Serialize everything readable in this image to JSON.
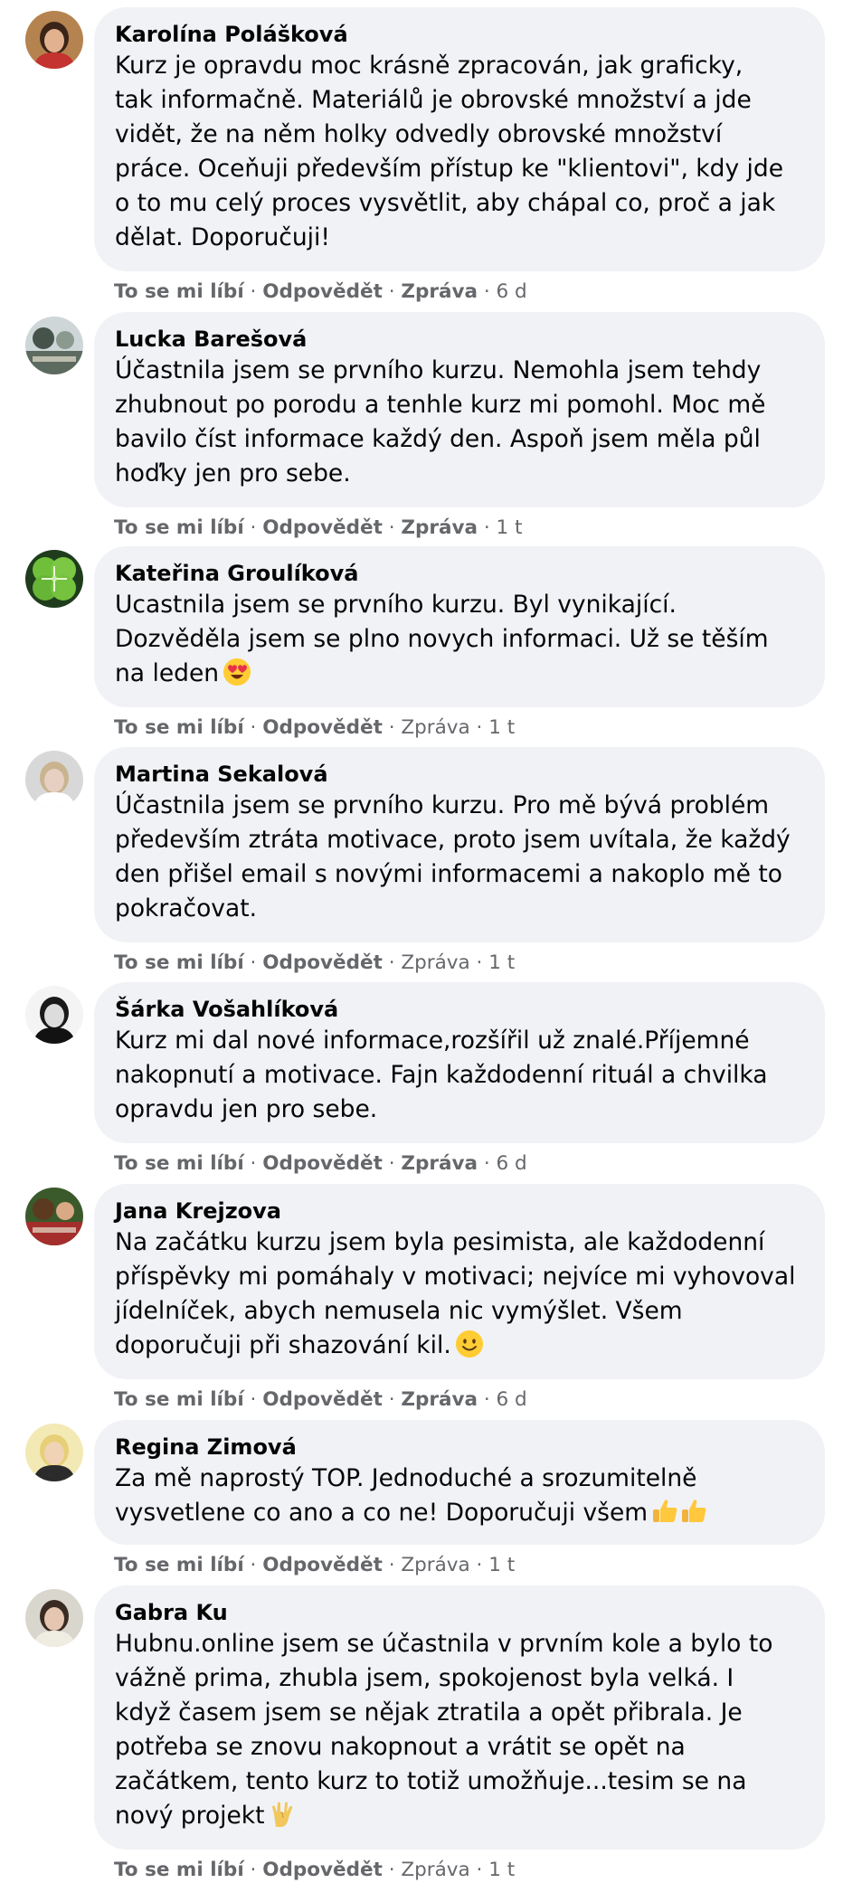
{
  "comments": [
    {
      "author": "Karolína Polášková",
      "lines": [
        "Kurz je opravdu moc krásně zpracován, jak graficky,",
        "tak informačně. Materiálů je obrovské množství a jde",
        "vidět, že na něm holky odvedly obrovské množství",
        "práce. Oceňuji především přístup ke \"klientovi\", kdy jde",
        "o to mu celý proces vysvětlit, aby chápal co, proč a jak",
        "dělat. Doporučuji!"
      ],
      "like": "To se mi líbí",
      "reply": "Odpovědět",
      "message": "Zpráva",
      "message_bold": true,
      "time": "6 d"
    },
    {
      "author": "Lucka Barešová",
      "lines": [
        "Účastnila jsem se prvního kurzu. Nemohla jsem tehdy",
        "zhubnout po porodu a tenhle kurz mi pomohl. Moc mě",
        "bavilo číst informace každý den. Aspoň jsem měla půl",
        "hoďky jen pro sebe."
      ],
      "like": "To se mi líbí",
      "reply": "Odpovědět",
      "message": "Zpráva",
      "message_bold": true,
      "time": "1 t"
    },
    {
      "author": "Kateřina Groulíková",
      "lines": [
        "Ucastnila jsem se prvního kurzu. Byl vynikající.",
        "Dozvěděla jsem se plno novych informaci. Už se těším",
        "na leden"
      ],
      "emoji": "heart-eyes-emoji",
      "like": "To se mi líbí",
      "reply": "Odpovědět",
      "message": "Zpráva",
      "message_bold": false,
      "time": "1 t"
    },
    {
      "author": "Martina Sekalová",
      "lines": [
        "Účastnila jsem se prvního kurzu. Pro mě bývá problém",
        "především ztráta motivace, proto jsem uvítala, že každý",
        "den přišel email s novými informacemi a nakoplo mě to",
        "pokračovat."
      ],
      "like": "To se mi líbí",
      "reply": "Odpovědět",
      "message": "Zpráva",
      "message_bold": false,
      "time": "1 t"
    },
    {
      "author": "Šárka Vošahlíková",
      "lines": [
        "Kurz mi dal nové informace,rozšířil už znalé.Příjemné",
        "nakopnutí a motivace. Fajn každodenní rituál a chvilka",
        "opravdu jen pro sebe."
      ],
      "like": "To se mi líbí",
      "reply": "Odpovědět",
      "message": "Zpráva",
      "message_bold": true,
      "time": "6 d"
    },
    {
      "author": "Jana Krejzova",
      "lines": [
        "Na začátku kurzu jsem byla pesimista, ale každodenní",
        "příspěvky mi pomáhaly v motivaci; nejvíce mi vyhovoval",
        "jídelníček, abych nemusela nic vymýšlet. Všem",
        "doporučuji při shazování kil."
      ],
      "emoji": "smile-emoji",
      "like": "To se mi líbí",
      "reply": "Odpovědět",
      "message": "Zpráva",
      "message_bold": true,
      "time": "6 d"
    },
    {
      "author": "Regina Zimová",
      "lines": [
        "Za mě naprostý TOP. Jednoduché a srozumitelně",
        "vysvetlene co ano a co ne! Doporučuji všem"
      ],
      "emoji": "thumbs-up-emoji",
      "like": "To se mi líbí",
      "reply": "Odpovědět",
      "message": "Zpráva",
      "message_bold": false,
      "time": "1 t"
    },
    {
      "author": "Gabra Ku",
      "lines": [
        "Hubnu.online jsem se účastnila v prvním kole a bylo to",
        "vážně prima, zhubla jsem, spokojenost byla velká. I",
        "když časem jsem se nějak ztratila a opět přibrala. Je",
        "potřeba se znovu nakopnout a vrátit se opět na",
        "začátkem, tento kurz to totiž umožňuje...tesim se na",
        "nový projekt"
      ],
      "emoji": "vulcan-salute-emoji",
      "like": "To se mi líbí",
      "reply": "Odpovědět",
      "message": "Zpráva",
      "message_bold": false,
      "time": "1 t"
    }
  ]
}
